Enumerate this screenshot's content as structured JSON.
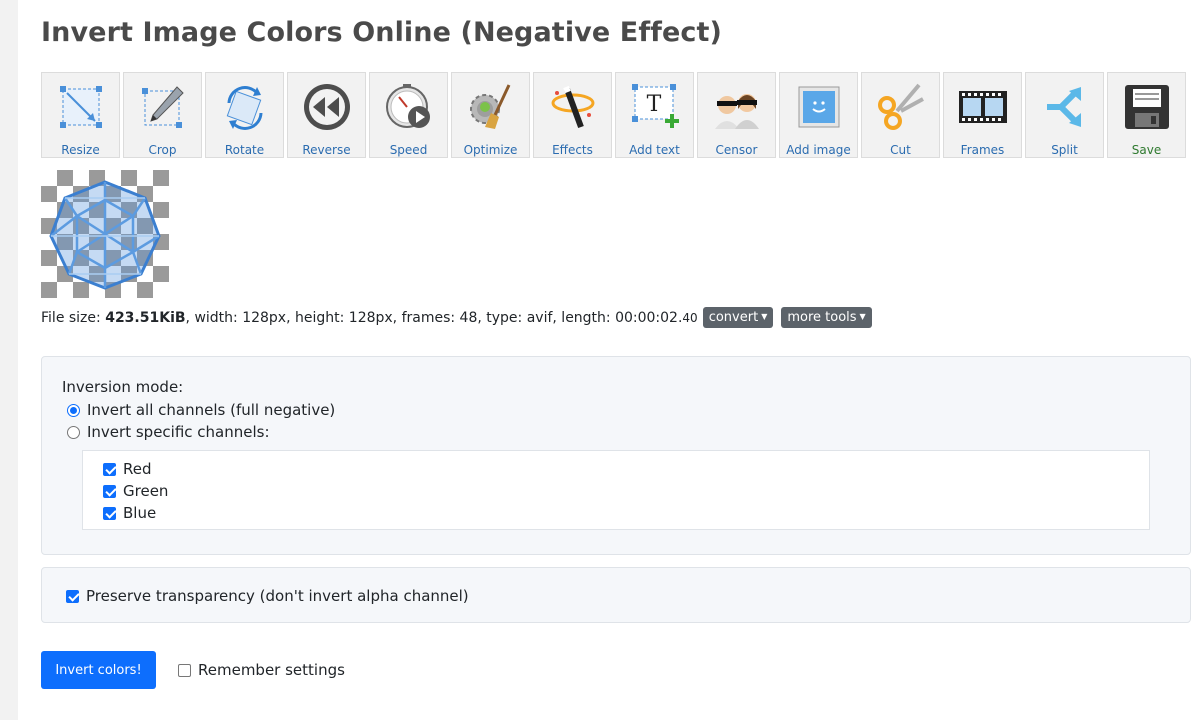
{
  "page_title": "Invert Image Colors Online (Negative Effect)",
  "toolbar": [
    {
      "label": "Resize",
      "icon": "resize-icon"
    },
    {
      "label": "Crop",
      "icon": "crop-icon"
    },
    {
      "label": "Rotate",
      "icon": "rotate-icon"
    },
    {
      "label": "Reverse",
      "icon": "reverse-icon"
    },
    {
      "label": "Speed",
      "icon": "speed-icon"
    },
    {
      "label": "Optimize",
      "icon": "optimize-icon"
    },
    {
      "label": "Effects",
      "icon": "effects-icon"
    },
    {
      "label": "Add text",
      "icon": "add-text-icon"
    },
    {
      "label": "Censor",
      "icon": "censor-icon"
    },
    {
      "label": "Add image",
      "icon": "add-image-icon"
    },
    {
      "label": "Cut",
      "icon": "cut-icon"
    },
    {
      "label": "Frames",
      "icon": "frames-icon"
    },
    {
      "label": "Split",
      "icon": "split-icon"
    },
    {
      "label": "Save",
      "icon": "save-icon"
    }
  ],
  "file_info": {
    "prefix": "File size: ",
    "size": "423.51KiB",
    "details": ", width: 128px, height: 128px, frames: 48, type: avif, length: 00:00:02.",
    "length_fraction": "40",
    "convert_label": "convert",
    "more_tools_label": "more tools"
  },
  "options": {
    "inversion_mode_label": "Inversion mode:",
    "radio_all": "Invert all channels (full negative)",
    "radio_specific": "Invert specific channels:",
    "selected_mode": "all",
    "channels": [
      {
        "label": "Red",
        "checked": true
      },
      {
        "label": "Green",
        "checked": true
      },
      {
        "label": "Blue",
        "checked": true
      }
    ],
    "preserve_transparency": "Preserve transparency (don't invert alpha channel)",
    "preserve_checked": true
  },
  "actions": {
    "submit_label": "Invert colors!",
    "remember_label": "Remember settings",
    "remember_checked": false
  },
  "colors": {
    "primary": "#0d6efd",
    "tool_label": "#2b6cb0",
    "save_label": "#2f7a2f",
    "dropdown_bg": "#5c636a"
  }
}
